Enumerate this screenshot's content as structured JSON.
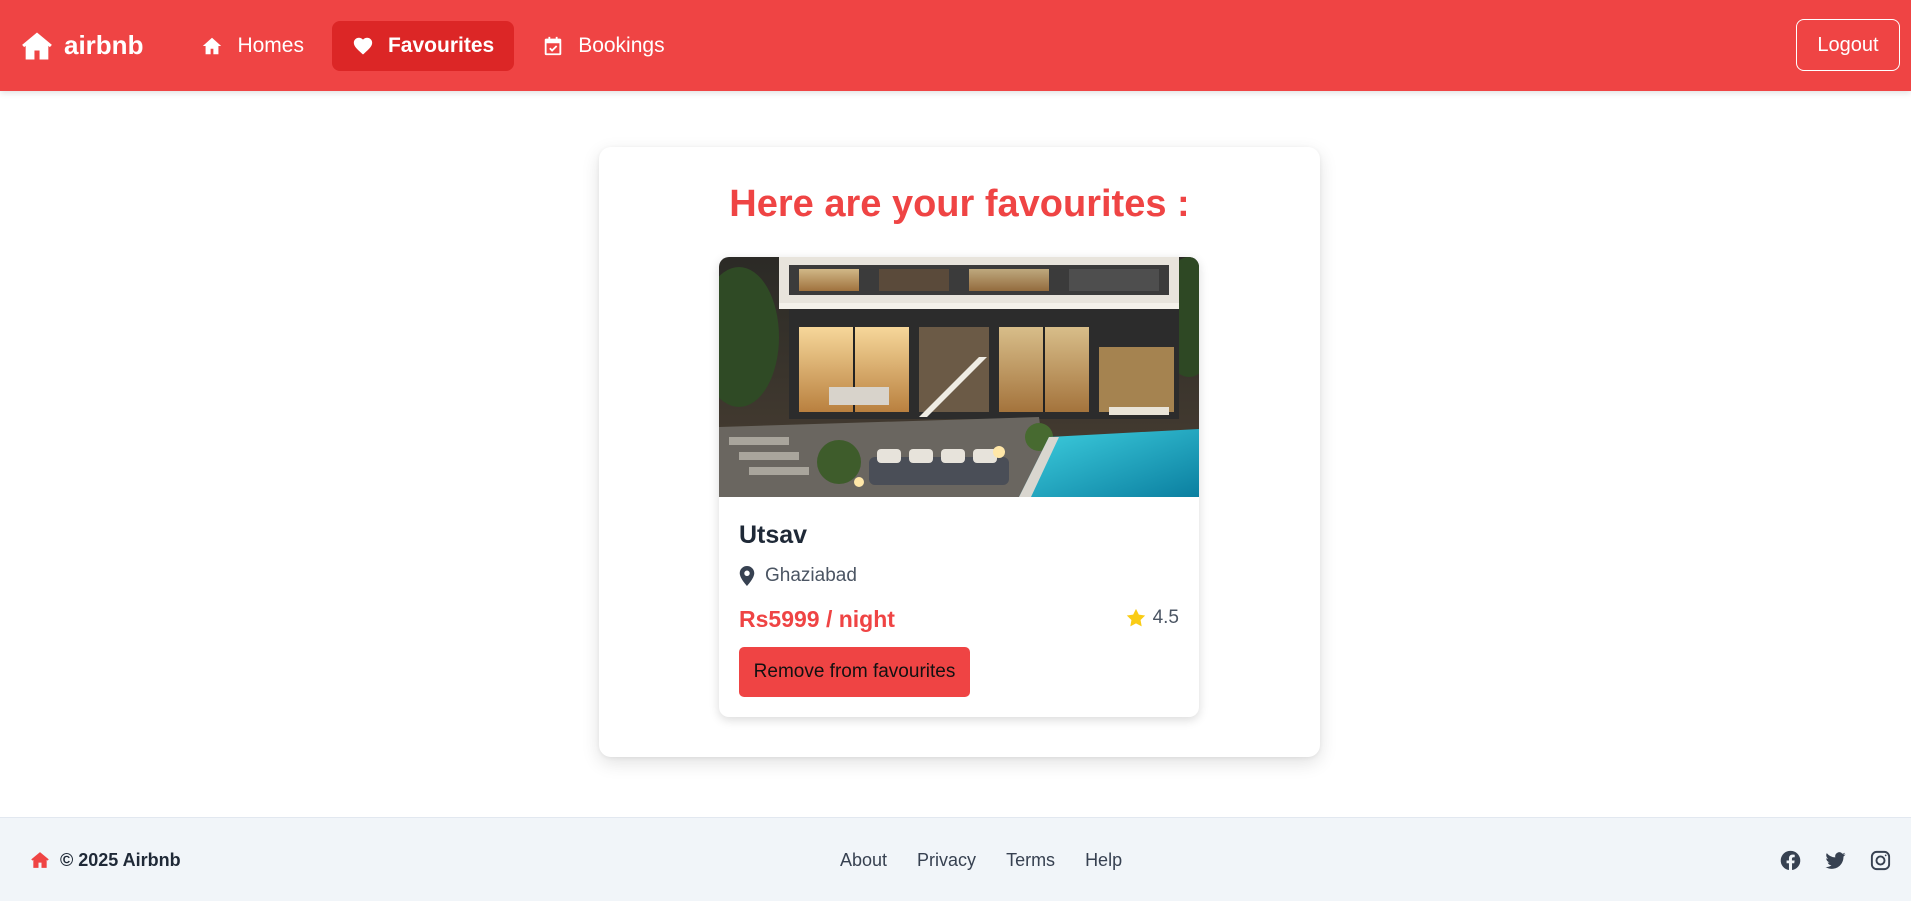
{
  "brand": {
    "name": "airbnb",
    "icon": "house-icon"
  },
  "nav": {
    "items": [
      {
        "label": "Homes",
        "icon": "home-icon",
        "active": false
      },
      {
        "label": "Favourites",
        "icon": "heart-icon",
        "active": true
      },
      {
        "label": "Bookings",
        "icon": "calendar-check-icon",
        "active": false
      }
    ],
    "logout_label": "Logout"
  },
  "page": {
    "title": "Here are your favourites :"
  },
  "favourites": [
    {
      "name": "Utsav",
      "location": "Ghaziabad",
      "price": "Rs5999 / night",
      "rating": "4.5",
      "button_label": "Remove from favourites"
    }
  ],
  "footer": {
    "copyright": "© 2025 Airbnb",
    "links": [
      "About",
      "Privacy",
      "Terms",
      "Help"
    ],
    "social": [
      "facebook-icon",
      "twitter-icon",
      "instagram-icon"
    ]
  },
  "colors": {
    "brand": "#ef4444",
    "brand_dark": "#dc2626",
    "star": "#facc15",
    "footer_bg": "#f1f5f9"
  }
}
